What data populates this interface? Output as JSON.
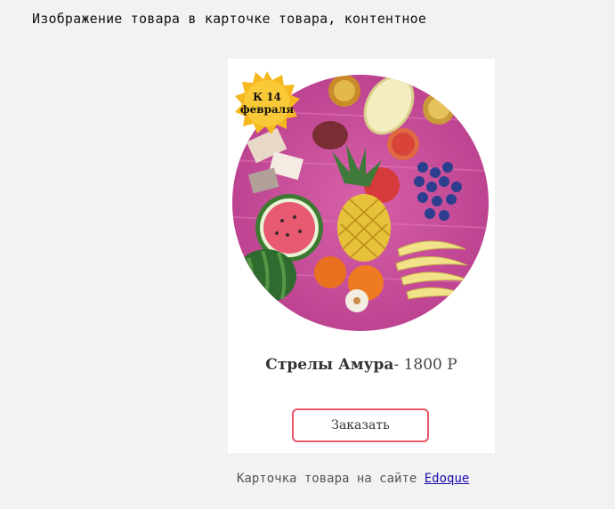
{
  "heading": "Изображение товара в карточке товара, контентное",
  "card": {
    "badge": {
      "line1": "К 14",
      "line2": "февраля"
    },
    "title": "Стрелы Амура",
    "price": "- 1800 Р",
    "order_label": "Заказать",
    "image_icon": "fruit-assortment-image"
  },
  "footer": {
    "text": "Карточка товара на сайте",
    "link_label": "Edoque"
  },
  "colors": {
    "background": "#f2f2f2",
    "card": "#ffffff",
    "button_border": "#e8566a",
    "link": "#1a0dab",
    "image_bg": "#c94f9a",
    "badge": "#f6b81f"
  }
}
